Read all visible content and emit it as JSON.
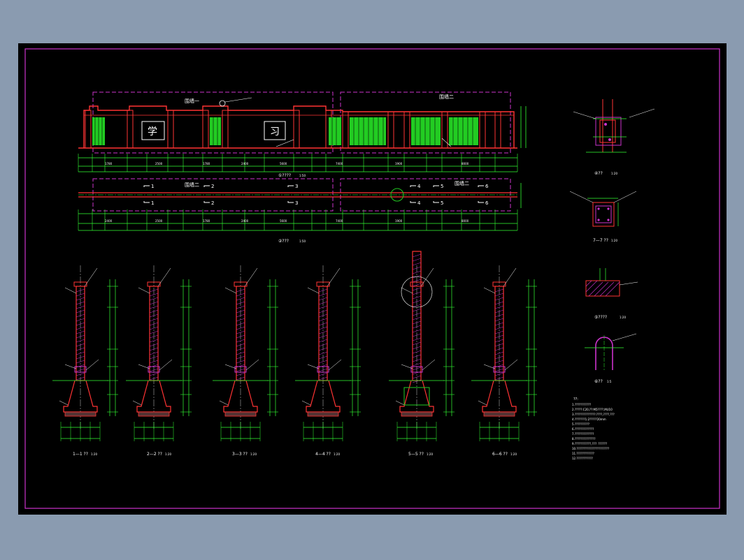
{
  "drawing": {
    "colors": {
      "background": "#8a9bb0",
      "canvas": "#000000",
      "frame": "#cc33cc",
      "dimension": "#33ff33",
      "outline": "#ff3333",
      "fill_green": "#22cc22",
      "section_line": "#cc33cc",
      "label": "#ffffff",
      "leader": "#ffffff",
      "note": "#ffffff",
      "hatch": "#cc33cc"
    },
    "elevation": {
      "title": "①????",
      "scale": "1:50",
      "zone_left_label": "围墙一",
      "zone_right_label": "围墙二",
      "char_left": "学",
      "char_right": "习",
      "dims": [
        "1780",
        "2500",
        "1780",
        "2400",
        "5600",
        "7400",
        "1900",
        "8000"
      ]
    },
    "plan": {
      "title": "②???",
      "scale": "1:50",
      "zone_left_label": "围墙二",
      "zone_right_label": "围墙二",
      "section_marks": [
        "1",
        "2",
        "3",
        "4",
        "5",
        "6"
      ],
      "dims": [
        "2400",
        "2500",
        "1780",
        "2400",
        "5600",
        "7400",
        "1900",
        "8000"
      ]
    },
    "sections": [
      {
        "label": "1—1 ??",
        "scale": "1:20"
      },
      {
        "label": "2—2 ??",
        "scale": "1:20"
      },
      {
        "label": "3—3 ??",
        "scale": "1:20"
      },
      {
        "label": "4—4 ??",
        "scale": "1:20"
      },
      {
        "label": "5—5 ??",
        "scale": "1:20"
      },
      {
        "label": "6—6 ??",
        "scale": "1:20"
      }
    ],
    "details": [
      {
        "label": "④??",
        "scale": "1:20"
      },
      {
        "label": "7—7 ??",
        "scale": "1:20"
      },
      {
        "label": "⑤????",
        "scale": "1:20"
      },
      {
        "label": "⑥??",
        "scale": "1:5"
      }
    ],
    "notes_title": "??:",
    "notes": [
      "1.???????????",
      "2.?????:C20,??:M5????,MU10",
      "3.??????????????:????,????,???",
      "4.???????1:2?????20mm",
      "5.??????????",
      "6.?????????????",
      "7.?????????????",
      "8.??????????????",
      "9.???????????,???: ??????",
      "10.??????????????????????",
      "11.????????????",
      "12.???????????"
    ]
  }
}
